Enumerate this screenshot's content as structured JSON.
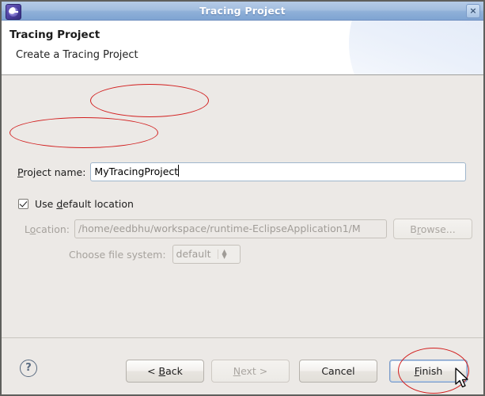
{
  "window": {
    "title": "Tracing Project",
    "icon": "eclipse-icon",
    "close_label": "×"
  },
  "header": {
    "title": "Tracing Project",
    "subtitle": "Create a Tracing Project"
  },
  "form": {
    "project_name": {
      "label_pre": "",
      "label_mnemonic": "P",
      "label_post": "roject name:",
      "value": "MyTracingProject"
    },
    "use_default_location": {
      "label_pre": "Use ",
      "label_mnemonic": "d",
      "label_post": "efault location",
      "checked": true
    },
    "location": {
      "label_pre": "L",
      "label_mnemonic": "o",
      "label_post": "cation:",
      "value": "/home/eedbhu/workspace/runtime-EclipseApplication1/M",
      "enabled": false
    },
    "browse": {
      "label_pre": "B",
      "label_mnemonic": "r",
      "label_post": "owse...",
      "enabled": false
    },
    "file_system": {
      "label": "Choose file system:",
      "value": "default",
      "enabled": false
    }
  },
  "footer": {
    "help_label": "?",
    "back": {
      "pre": "< ",
      "mnemonic": "B",
      "post": "ack"
    },
    "next": {
      "pre": "",
      "mnemonic": "N",
      "post": "ext >"
    },
    "cancel": {
      "pre": "Cancel",
      "mnemonic": "",
      "post": ""
    },
    "finish": {
      "pre": "",
      "mnemonic": "F",
      "post": "inish"
    }
  },
  "annotations": {
    "color": "#d21f1f",
    "shapes": [
      "ellipse-project-name",
      "ellipse-use-default",
      "ellipse-finish"
    ]
  }
}
